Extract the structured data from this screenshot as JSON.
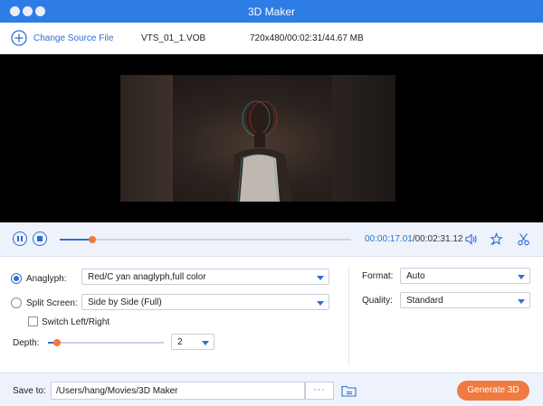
{
  "window": {
    "title": "3D Maker"
  },
  "source": {
    "change_label": "Change Source File",
    "file_name": "VTS_01_1.VOB",
    "file_info": "720x480/00:02:31/44.67 MB"
  },
  "playback": {
    "progress": 0.113,
    "current_time": "00:00:17.01",
    "separator": "/",
    "total_time": "00:02:31.12"
  },
  "settings": {
    "anaglyph": {
      "label": "Anaglyph:",
      "selected": true,
      "value": "Red/C yan anaglyph,full color"
    },
    "split_screen": {
      "label": "Split Screen:",
      "selected": false,
      "value": "Side by Side (Full)"
    },
    "switch_lr": {
      "label": "Switch Left/Right",
      "checked": false
    },
    "depth": {
      "label": "Depth:",
      "value": "2",
      "level": 0.08
    },
    "format": {
      "label": "Format:",
      "value": "Auto"
    },
    "quality": {
      "label": "Quality:",
      "value": "Standard"
    }
  },
  "output": {
    "save_label": "Save to:",
    "path": "/Users/hang/Movies/3D Maker",
    "browse_label": "···",
    "generate_label": "Generate 3D"
  },
  "colors": {
    "accent": "#2e6fd1",
    "titlebar": "#2e7ce6",
    "action": "#f07a3f",
    "knob": "#f37a35"
  }
}
